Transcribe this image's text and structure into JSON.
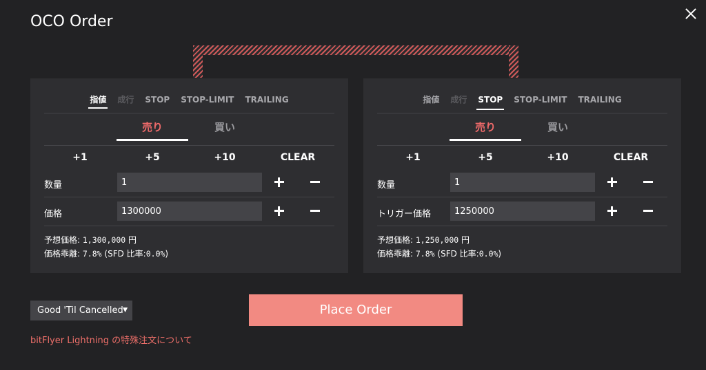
{
  "dialog": {
    "title": "OCO Order"
  },
  "panels": [
    {
      "tabs": [
        {
          "label": "指値",
          "state": "active"
        },
        {
          "label": "成行",
          "state": "disabled"
        },
        {
          "label": "STOP",
          "state": "normal"
        },
        {
          "label": "STOP-LIMIT",
          "state": "normal"
        },
        {
          "label": "TRAILING",
          "state": "normal"
        }
      ],
      "sides": {
        "sell": "売り",
        "buy": "買い",
        "selected": "sell"
      },
      "quick": [
        "+1",
        "+5",
        "+10",
        "CLEAR"
      ],
      "qty": {
        "label": "数量",
        "value": "1"
      },
      "price": {
        "label": "価格",
        "value": "1300000"
      },
      "expected": {
        "label": "予想価格:",
        "value": "1,300,000",
        "unit": "円"
      },
      "deviation": {
        "label": "価格乖離:",
        "value": "7.8%",
        "sfd_prefix": "(SFD 比率:",
        "sfd_value": "0.0%",
        "sfd_suffix": ")"
      }
    },
    {
      "tabs": [
        {
          "label": "指値",
          "state": "normal"
        },
        {
          "label": "成行",
          "state": "disabled"
        },
        {
          "label": "STOP",
          "state": "active"
        },
        {
          "label": "STOP-LIMIT",
          "state": "normal"
        },
        {
          "label": "TRAILING",
          "state": "normal"
        }
      ],
      "sides": {
        "sell": "売り",
        "buy": "買い",
        "selected": "sell"
      },
      "quick": [
        "+1",
        "+5",
        "+10",
        "CLEAR"
      ],
      "qty": {
        "label": "数量",
        "value": "1"
      },
      "price": {
        "label": "トリガー価格",
        "value": "1250000"
      },
      "expected": {
        "label": "予想価格:",
        "value": "1,250,000",
        "unit": "円"
      },
      "deviation": {
        "label": "価格乖離:",
        "value": "7.8%",
        "sfd_prefix": "(SFD 比率:",
        "sfd_value": "0.0%",
        "sfd_suffix": ")"
      }
    }
  ],
  "time_in_force": {
    "selected": "Good 'Til Cancelled"
  },
  "place_order": {
    "label": "Place Order"
  },
  "special_order_link": {
    "label": "bitFlyer Lightning の特殊注文について"
  },
  "colors": {
    "accent_red": "#ef6a6a",
    "button": "#f28a82",
    "link": "#f0706a"
  }
}
